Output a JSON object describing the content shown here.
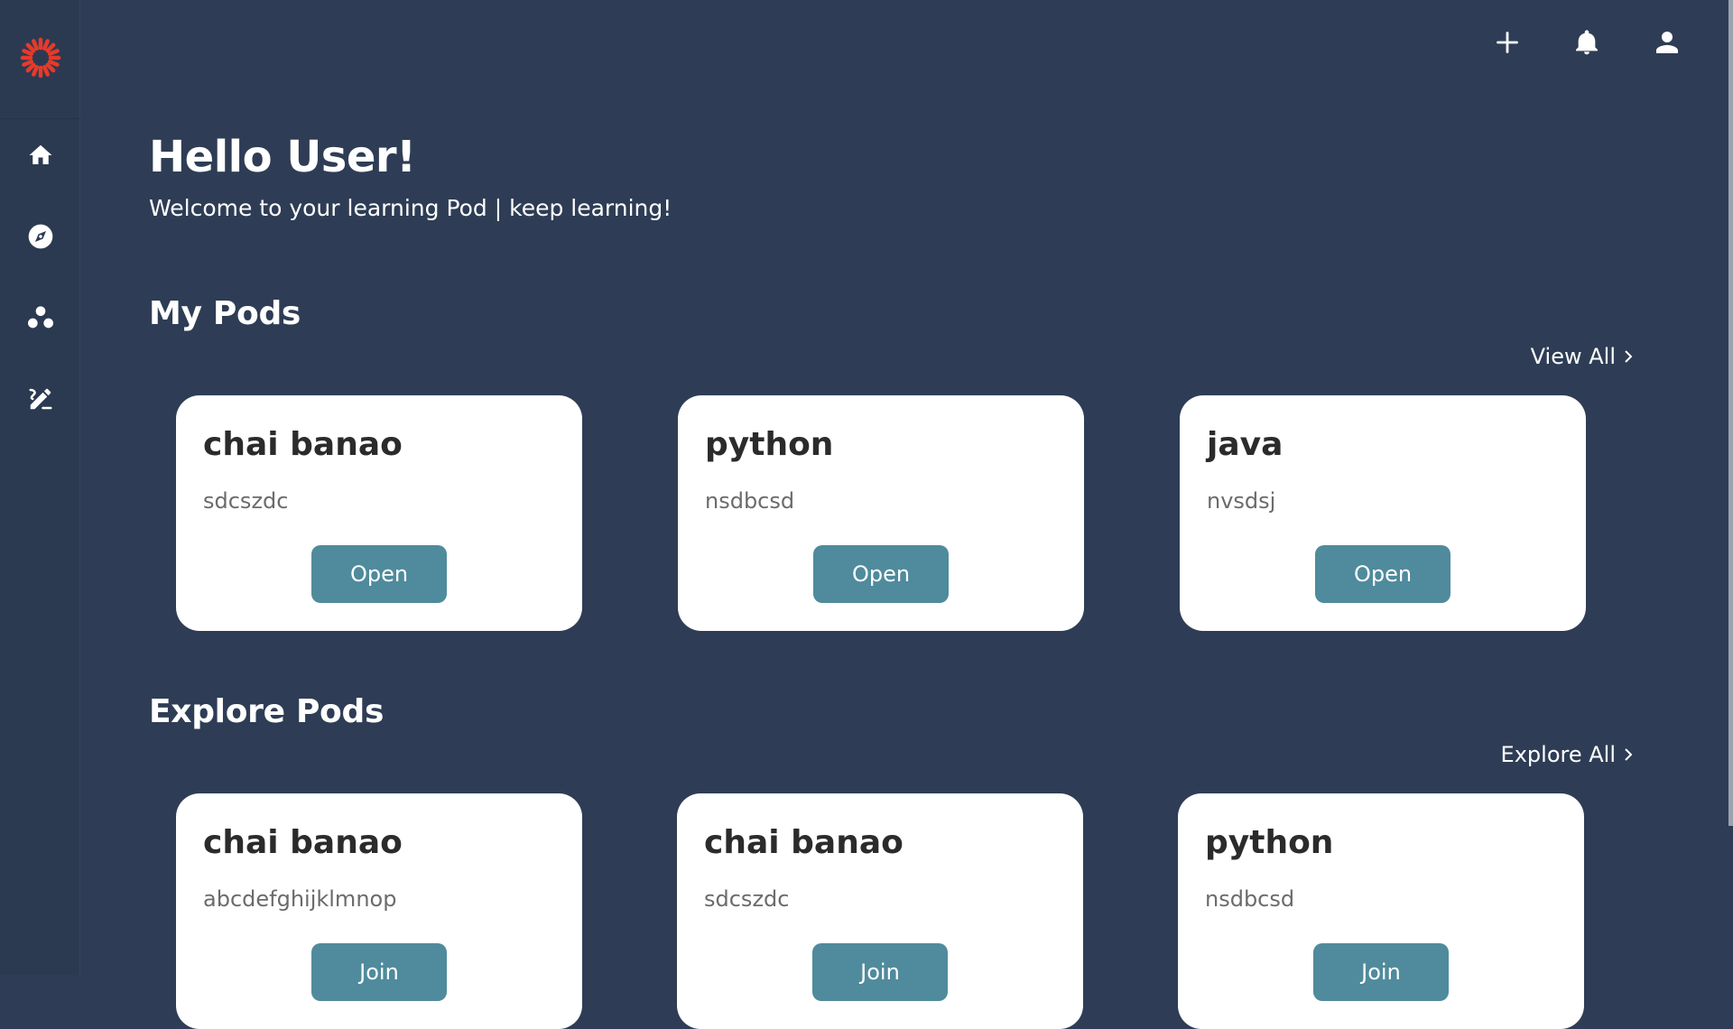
{
  "header": {
    "greeting": "Hello User!",
    "subtitle": "Welcome to your learning Pod | keep learning!"
  },
  "topbar": {
    "icons": [
      "plus-icon",
      "bell-icon",
      "user-icon"
    ]
  },
  "sidebar": {
    "logo": "sun-logo",
    "items": [
      "home-icon",
      "compass-icon",
      "group-icon",
      "edit-icon"
    ]
  },
  "my_pods": {
    "title": "My Pods",
    "view_all": "View All",
    "cards": [
      {
        "title": "chai banao",
        "desc": "sdcszdc",
        "button": "Open"
      },
      {
        "title": "python",
        "desc": "nsdbcsd",
        "button": "Open"
      },
      {
        "title": "java",
        "desc": "nvsdsj",
        "button": "Open"
      }
    ]
  },
  "explore_pods": {
    "title": "Explore Pods",
    "view_all": "Explore All",
    "cards": [
      {
        "title": "chai banao",
        "desc": "abcdefghijklmnop",
        "button": "Join"
      },
      {
        "title": "chai banao",
        "desc": "sdcszdc",
        "button": "Join"
      },
      {
        "title": "python",
        "desc": "nsdbcsd",
        "button": "Join"
      }
    ]
  },
  "colors": {
    "background": "#2e3d55",
    "card": "#ffffff",
    "button": "#4f8b9c",
    "logo": "#e63a2a"
  }
}
